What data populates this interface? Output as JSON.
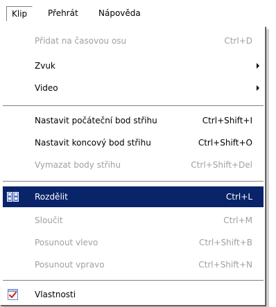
{
  "menubar": {
    "items": [
      {
        "label": "Klip",
        "active": true
      },
      {
        "label": "Přehrát",
        "active": false
      },
      {
        "label": "Nápověda",
        "active": false
      }
    ]
  },
  "menu": {
    "items": [
      {
        "label": "Přidat na časovou osu",
        "shortcut": "Ctrl+D",
        "enabled": false
      },
      {
        "label": "Zvuk",
        "submenu": true,
        "enabled": true
      },
      {
        "label": "Video",
        "submenu": true,
        "enabled": true
      },
      {
        "label": "Nastavit počáteční bod střihu",
        "shortcut": "Ctrl+Shift+I",
        "enabled": true
      },
      {
        "label": "Nastavit koncový bod střihu",
        "shortcut": "Ctrl+Shift+O",
        "enabled": true
      },
      {
        "label": "Vymazat body střihu",
        "shortcut": "Ctrl+Shift+Del",
        "enabled": false
      },
      {
        "label": "Rozdělit",
        "shortcut": "Ctrl+L",
        "enabled": true,
        "selected": true,
        "icon": "split-clip-icon"
      },
      {
        "label": "Sloučit",
        "shortcut": "Ctrl+M",
        "enabled": false
      },
      {
        "label": "Posunout vlevo",
        "shortcut": "Ctrl+Shift+B",
        "enabled": false
      },
      {
        "label": "Posunout vpravo",
        "shortcut": "Ctrl+Shift+N",
        "enabled": false
      },
      {
        "label": "Vlastnosti",
        "enabled": true,
        "icon": "properties-checkmark-icon"
      }
    ]
  },
  "colors": {
    "highlight": "#0a246a",
    "disabled_text": "#a0a0a0",
    "menu_background": "#ffffff"
  }
}
